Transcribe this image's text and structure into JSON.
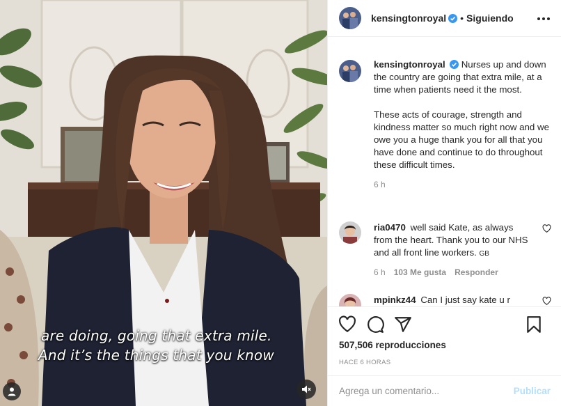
{
  "video": {
    "subtitle_line1": "are doing, going that extra mile.",
    "subtitle_line2": "And it’s the things that you know",
    "mute_icon": "muted-speaker-icon",
    "user_tag_icon": "user-tag-icon"
  },
  "header": {
    "username": "kensingtonroyal",
    "separator": "•",
    "follow_label": "Siguiendo",
    "more_icon": "more-options-icon"
  },
  "caption": {
    "username": "kensingtonroyal",
    "paragraph1": "Nurses up and down the country are going that extra mile, at a time when patients need it the most.",
    "paragraph2": "These acts of courage, strength and kindness matter so much right now and we owe you a huge thank you for all that you have done and continue to do throughout these difficult times.",
    "time": "6 h"
  },
  "comments": [
    {
      "username": "ria0470",
      "text": "well said Kate, as always from the heart. Thank you to our NHS and all front line workers.",
      "flag": "GB",
      "time": "6 h",
      "likes": "103 Me gusta",
      "reply_label": "Responder"
    },
    {
      "username": "mpinkz44",
      "text": "Can I just say kate u r",
      "time": "",
      "likes": "",
      "reply_label": ""
    }
  ],
  "actions": {
    "like_icon": "heart-icon",
    "comment_icon": "comment-icon",
    "share_icon": "share-icon",
    "save_icon": "bookmark-icon",
    "views": "507,506 reproducciones",
    "posted": "HACE 6 HORAS"
  },
  "add_comment": {
    "placeholder": "Agrega un comentario...",
    "post_label": "Publicar"
  },
  "colors": {
    "verified": "#3897f0",
    "link_disabled": "#b2dffc",
    "muted_text": "#8e8e8e"
  }
}
